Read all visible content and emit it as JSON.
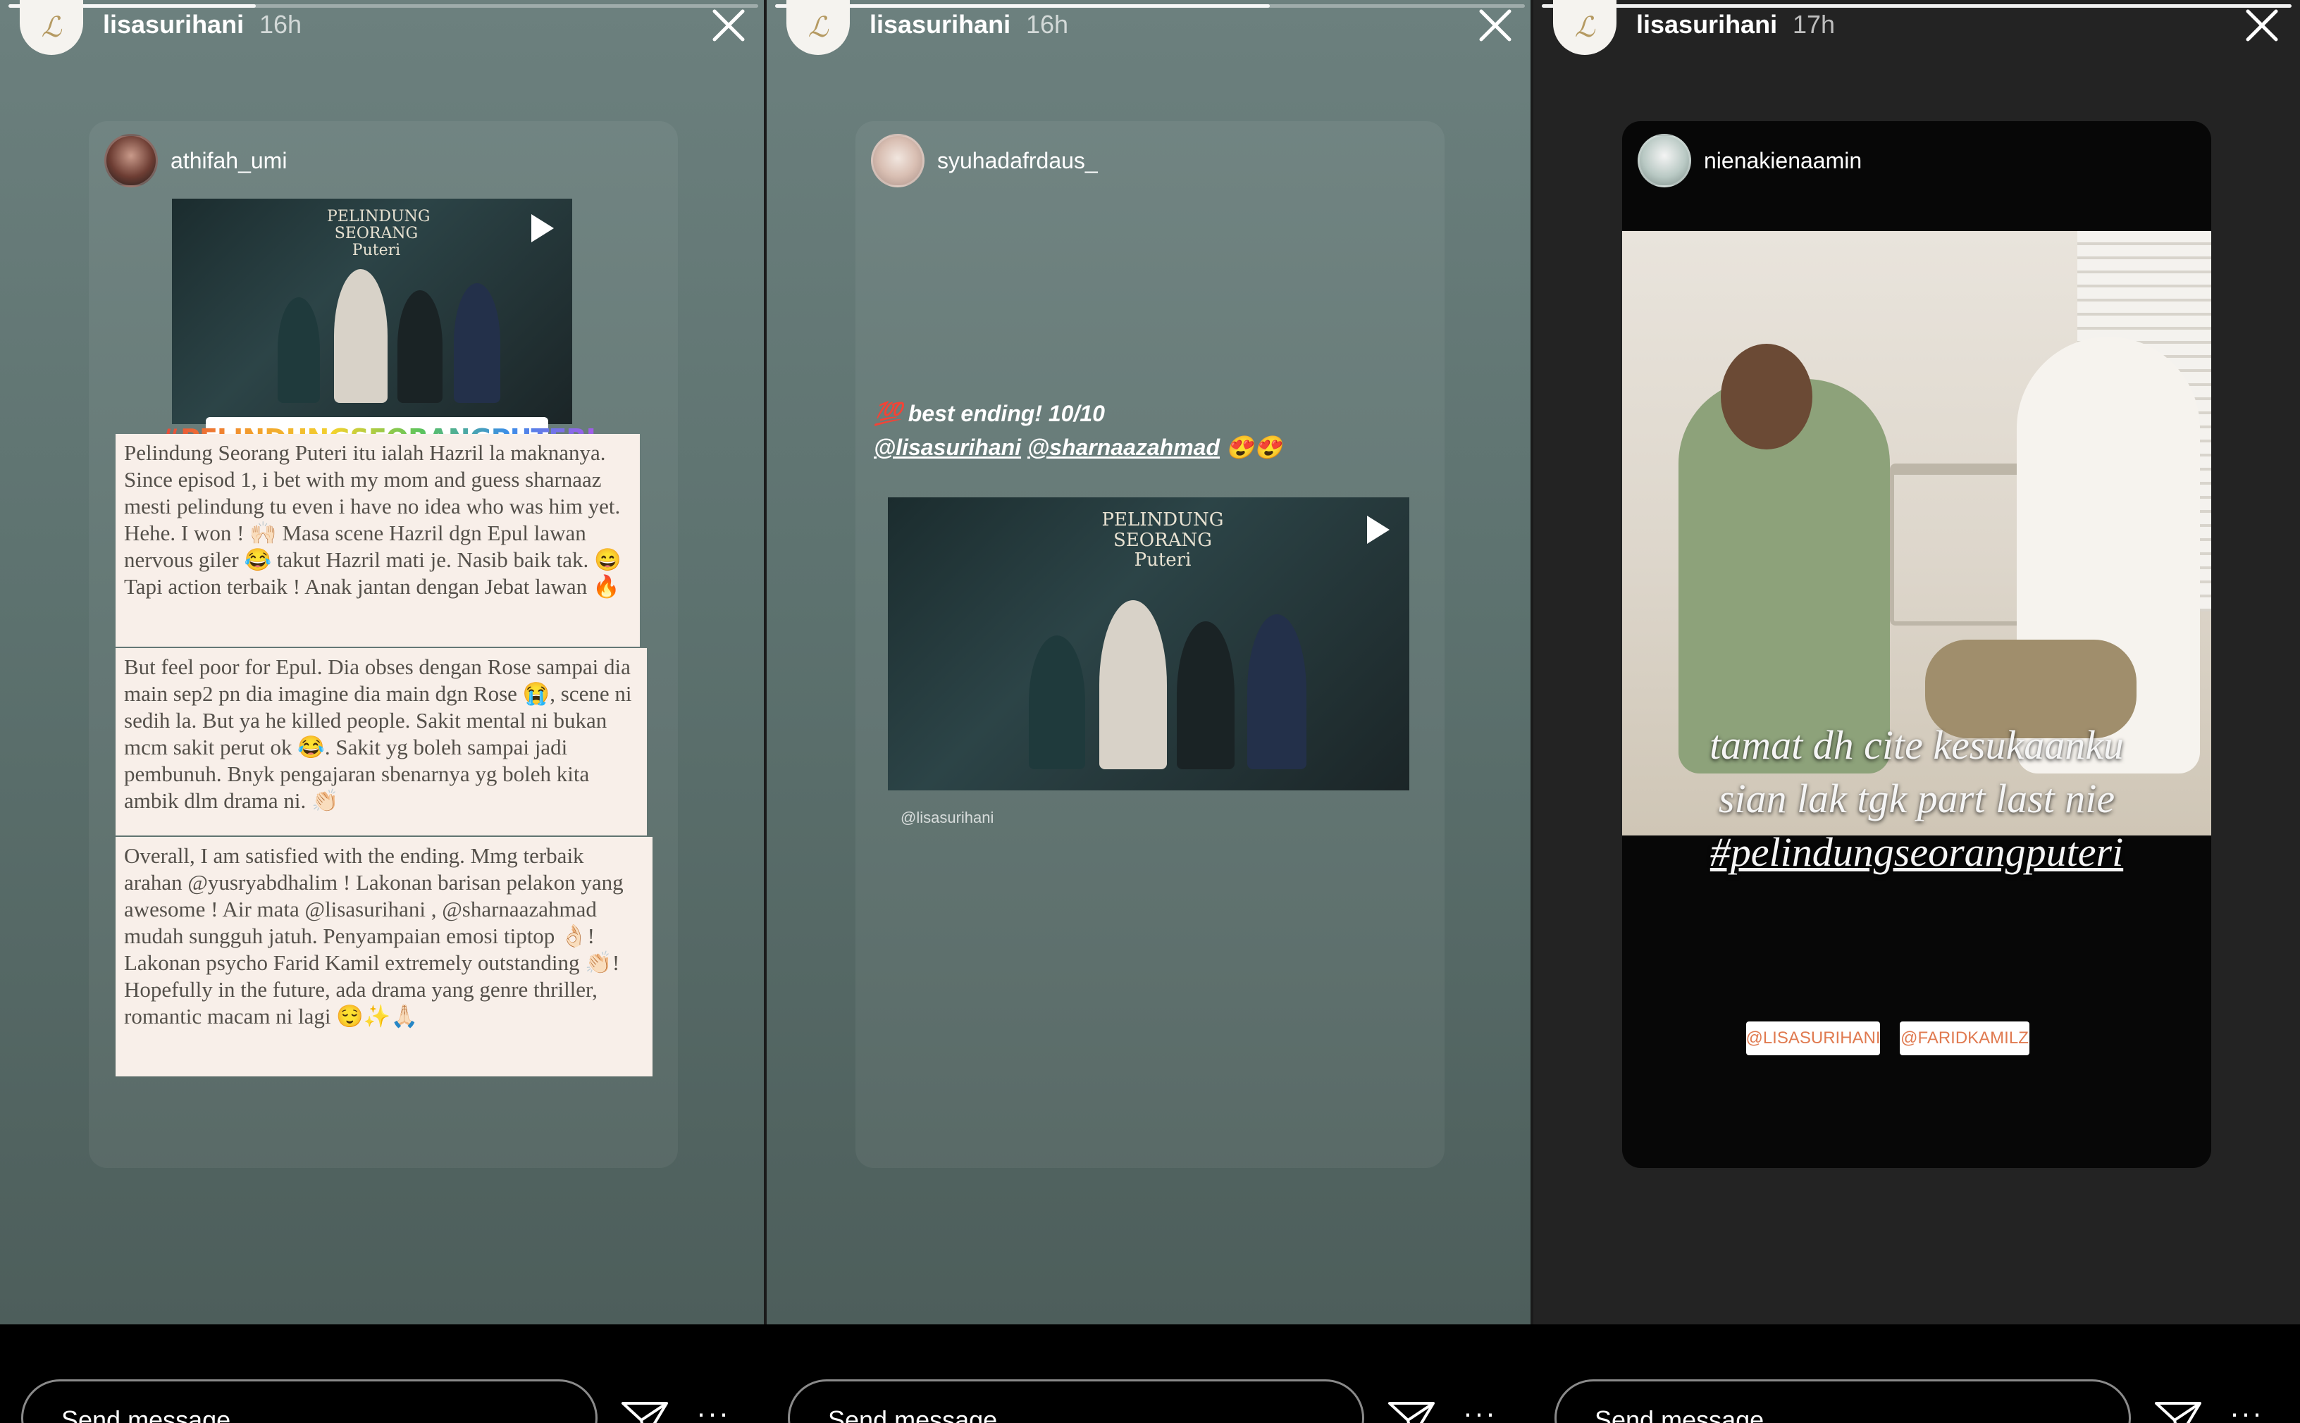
{
  "stories": [
    {
      "header": {
        "username": "lisasurihani",
        "time": "16h",
        "progress": 0.33
      },
      "card": {
        "username": "athifah_umi",
        "hashtag": "#PELINDUNGSEORANGPUTERI",
        "note_paragraphs": [
          "Pelindung Seorang Puteri itu ialah Hazril la maknanya. Since episod 1, i bet with my mom and guess sharnaaz mesti pelindung tu even i have no idea who was him yet. Hehe. I won ! 🙌🏻 Masa scene Hazril dgn Epul lawan nervous giler 😂 takut Hazril mati je. Nasib baik tak. 😄 Tapi action terbaik ! Anak jantan dengan Jebat lawan 🔥",
          "But feel poor for Epul. Dia obses dengan Rose sampai dia main sep2 pn dia imagine dia main dgn Rose 😭, scene ni sedih la. But ya he killed people. Sakit mental ni bukan mcm sakit perut ok 😂. Sakit yg boleh sampai jadi pembunuh. Bnyk pengajaran sbenarnya yg boleh kita ambik dlm drama ni. 👏🏻",
          "Overall, I am satisfied with the ending. Mmg terbaik arahan @yusryabdhalim ! Lakonan barisan pelakon yang awesome ! Air mata @lisasurihani , @sharnaazahmad mudah sungguh jatuh. Penyampaian emosi tiptop 👌🏻! Lakonan psycho Farid Kamil extremely outstanding 👏🏻! Hopefully in the future, ada drama yang genre thriller, romantic macam ni lagi 😌✨🙏🏻"
        ]
      },
      "message_placeholder": "Send message"
    },
    {
      "header": {
        "username": "lisasurihani",
        "time": "16h",
        "progress": 0.66
      },
      "card": {
        "username": "syuhadafrdaus_",
        "caption_line1": "💯 best ending! 10/10",
        "caption_mention1": "@lisasurihani",
        "caption_mention2": "@sharnaazahmad",
        "caption_emoji": "😍😍",
        "video_title": "PELINDUNG SEORANG Puteri",
        "share_credit": "@lisasurihani"
      },
      "message_placeholder": "Send message"
    },
    {
      "header": {
        "username": "lisasurihani",
        "time": "17h",
        "progress": 1.0
      },
      "card": {
        "username": "nienakienaamin",
        "overlay_line1": "tamat dh cite kesukaanku",
        "overlay_line2": "sian lak tgk part last nie",
        "overlay_line3": "#pelindungseorangputeri",
        "tag1": "@LISASURIHANI",
        "tag2": "@FARIDKAMILZ"
      },
      "message_placeholder": "Send message"
    }
  ],
  "thumb_title": "PELINDUNG SEORANG Puteri",
  "colors": {
    "story_bg": "#5d726f",
    "note_bg": "#f8efe9",
    "dark_bg": "#232323"
  },
  "icons": {
    "close": "close-icon",
    "send": "send-icon",
    "more": "more-icon",
    "play": "play-icon"
  }
}
